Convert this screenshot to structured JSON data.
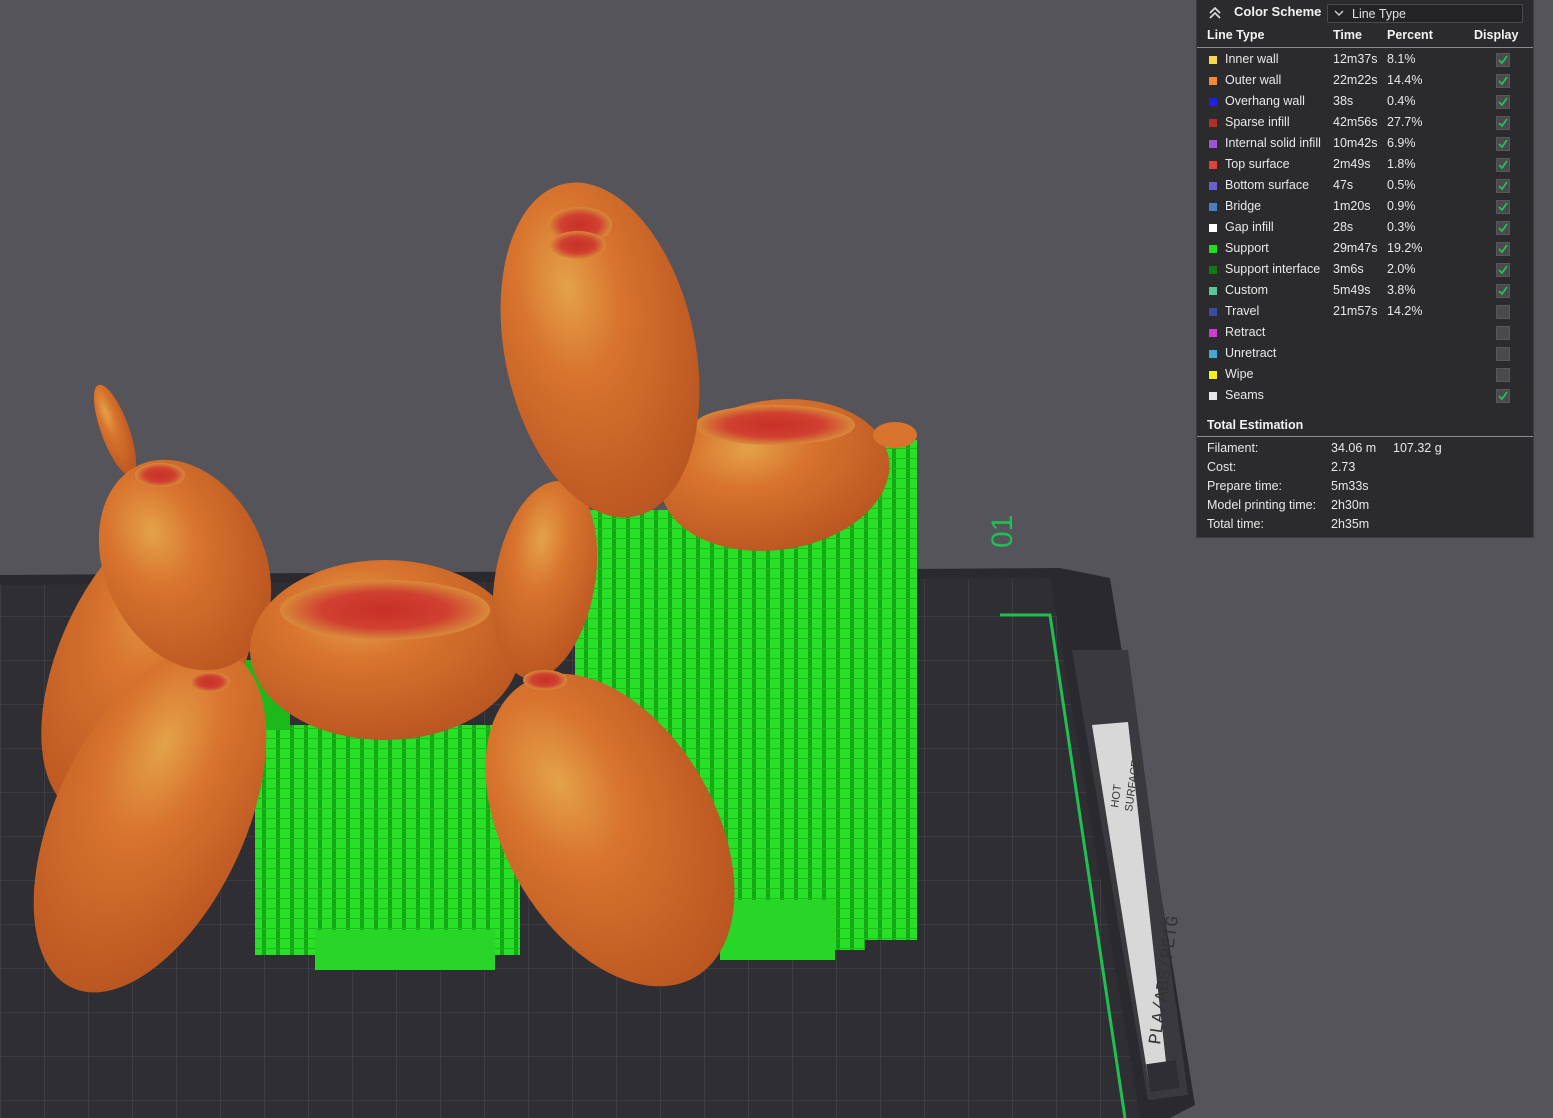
{
  "legend": {
    "title": "Color Scheme",
    "scheme_value": "Line Type",
    "columns": {
      "line_type": "Line Type",
      "time": "Time",
      "percent": "Percent",
      "display": "Display"
    },
    "rows": [
      {
        "name": "Inner wall",
        "time": "12m37s",
        "percent": "8.1%",
        "color": "#f2d84a",
        "display": true
      },
      {
        "name": "Outer wall",
        "time": "22m22s",
        "percent": "14.4%",
        "color": "#ee8a3a",
        "display": true
      },
      {
        "name": "Overhang wall",
        "time": "38s",
        "percent": "0.4%",
        "color": "#2020e6",
        "display": true
      },
      {
        "name": "Sparse infill",
        "time": "42m56s",
        "percent": "27.7%",
        "color": "#b03028",
        "display": true
      },
      {
        "name": "Internal solid infill",
        "time": "10m42s",
        "percent": "6.9%",
        "color": "#9b57d3",
        "display": true
      },
      {
        "name": "Top surface",
        "time": "2m49s",
        "percent": "1.8%",
        "color": "#e0443a",
        "display": true
      },
      {
        "name": "Bottom surface",
        "time": "47s",
        "percent": "0.5%",
        "color": "#6a5fd0",
        "display": true
      },
      {
        "name": "Bridge",
        "time": "1m20s",
        "percent": "0.9%",
        "color": "#4b7fc4",
        "display": true
      },
      {
        "name": "Gap infill",
        "time": "28s",
        "percent": "0.3%",
        "color": "#ffffff",
        "display": true
      },
      {
        "name": "Support",
        "time": "29m47s",
        "percent": "19.2%",
        "color": "#1ee01e",
        "display": true
      },
      {
        "name": "Support interface",
        "time": "3m6s",
        "percent": "2.0%",
        "color": "#137a13",
        "display": true
      },
      {
        "name": "Custom",
        "time": "5m49s",
        "percent": "3.8%",
        "color": "#5ec49a",
        "display": true
      },
      {
        "name": "Travel",
        "time": "21m57s",
        "percent": "14.2%",
        "color": "#3c4aa8",
        "display": false
      },
      {
        "name": "Retract",
        "time": "",
        "percent": "",
        "color": "#d23cd2",
        "display": false
      },
      {
        "name": "Unretract",
        "time": "",
        "percent": "",
        "color": "#48a8d4",
        "display": false
      },
      {
        "name": "Wipe",
        "time": "",
        "percent": "",
        "color": "#f0f020",
        "display": false
      },
      {
        "name": "Seams",
        "time": "",
        "percent": "",
        "color": "#e8e8e8",
        "display": true
      }
    ],
    "total_estimation": {
      "title": "Total Estimation",
      "filament_label": "Filament:",
      "filament_length": "34.06 m",
      "filament_weight": "107.32 g",
      "cost_label": "Cost:",
      "cost": "2.73",
      "prepare_label": "Prepare time:",
      "prepare": "5m33s",
      "model_label": "Model printing time:",
      "model": "2h30m",
      "total_label": "Total time:",
      "total": "2h35m"
    }
  },
  "plate": {
    "plate_number": "01",
    "material_label": "PLA/ABS/PETG",
    "warning_label_1": "HOT",
    "warning_label_2": "SURFACE"
  },
  "colors": {
    "background": "#55545a",
    "plate": "#2f2f33",
    "grid": "#4a4a50",
    "model": "#d2692a",
    "support": "#22dd22",
    "accent": "#1fbf52"
  }
}
